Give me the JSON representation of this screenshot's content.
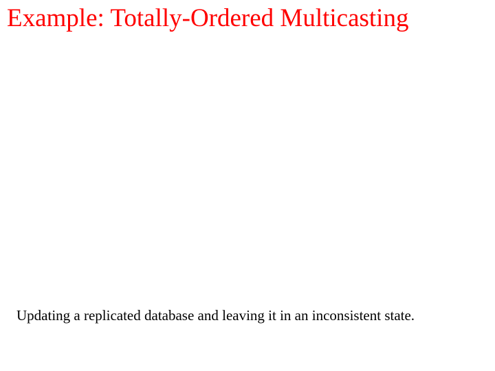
{
  "slide": {
    "title": "Example: Totally-Ordered Multicasting",
    "caption": "Updating a replicated database and leaving it in an inconsistent state."
  }
}
